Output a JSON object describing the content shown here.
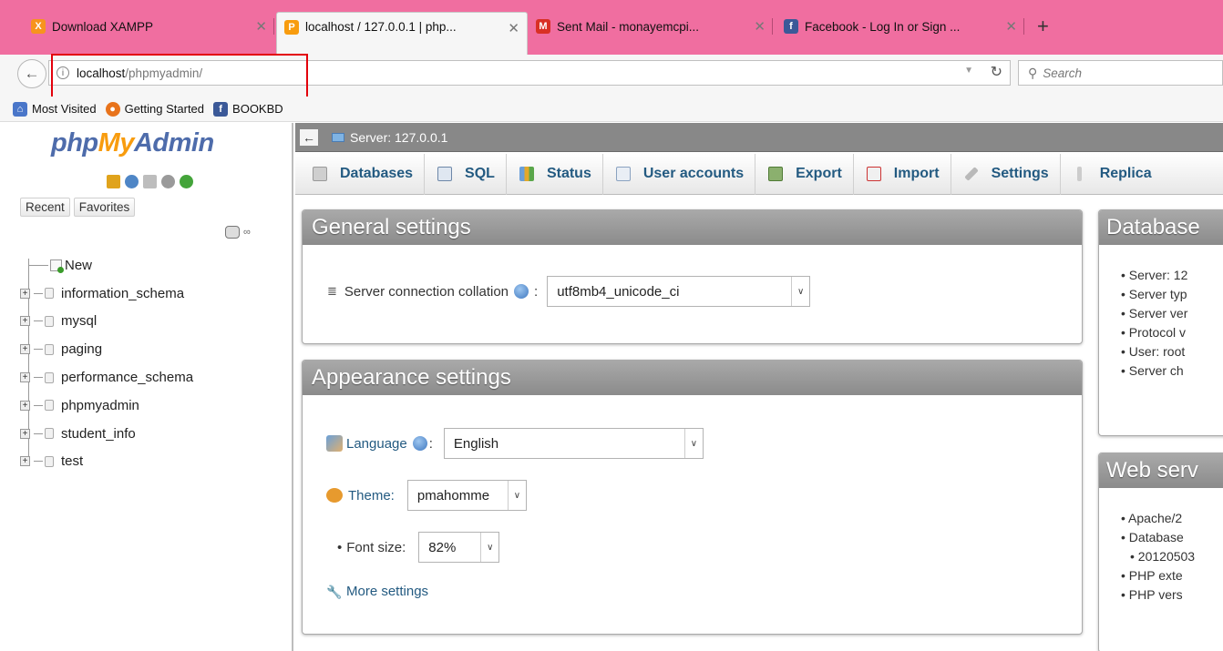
{
  "browser": {
    "tabs": [
      {
        "title": "Download XAMPP",
        "color": "#f7941d",
        "glyph": "X"
      },
      {
        "title": "localhost / 127.0.0.1 | php...",
        "color": "#f89c0e",
        "glyph": "P"
      },
      {
        "title": "Sent Mail - monayemcpi...",
        "color": "#d93025",
        "glyph": "M"
      },
      {
        "title": "Facebook - Log In or Sign ...",
        "color": "#3b5998",
        "glyph": "f"
      }
    ],
    "new_tab": "+",
    "url_host": "localhost",
    "url_path": "/phpmyadmin/",
    "search_placeholder": "Search",
    "bookmarks": [
      {
        "label": "Most Visited",
        "color": "#4a76c9"
      },
      {
        "label": "Getting Started",
        "color": "#e8731b"
      },
      {
        "label": "BOOKBD",
        "color": "#3b5998"
      }
    ]
  },
  "left": {
    "logo_php": "php",
    "logo_my": "My",
    "logo_admin": "Admin",
    "recent": "Recent",
    "favorites": "Favorites",
    "new_label": "New",
    "databases": [
      "information_schema",
      "mysql",
      "paging",
      "performance_schema",
      "phpmyadmin",
      "student_info",
      "test"
    ]
  },
  "main": {
    "server_crumb": "Server: 127.0.0.1",
    "tabs": [
      "Databases",
      "SQL",
      "Status",
      "User accounts",
      "Export",
      "Import",
      "Settings",
      "Replica"
    ],
    "general": {
      "title": "General settings",
      "collation_label": "Server connection collation",
      "collation_value": "utf8mb4_unicode_ci"
    },
    "appearance": {
      "title": "Appearance settings",
      "language_label": "Language",
      "language_value": "English",
      "theme_label": "Theme:",
      "theme_value": "pmahomme",
      "fontsize_label": "Font size:",
      "fontsize_value": "82%",
      "more_settings": "More settings"
    },
    "database_server": {
      "title": "Database",
      "items": [
        "Server: 12",
        "Server typ",
        "Server ver",
        "Protocol v",
        "User: root",
        "Server ch"
      ]
    },
    "web_server": {
      "title": "Web serv",
      "items": [
        "Apache/2",
        "Database",
        "20120503",
        "PHP exte",
        "PHP vers"
      ]
    }
  }
}
